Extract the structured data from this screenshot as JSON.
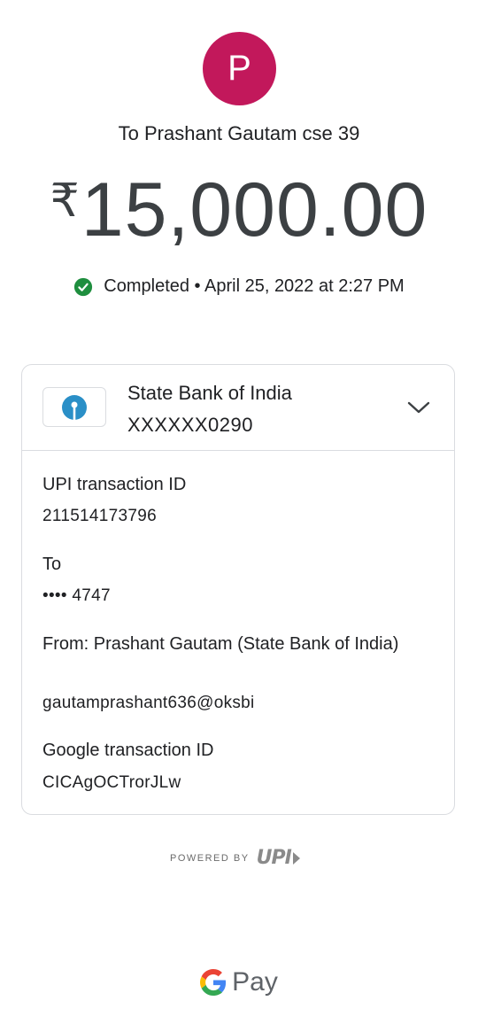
{
  "avatar": {
    "initial": "P",
    "color": "#c2185b"
  },
  "header": {
    "recipient_line": "To Prashant Gautam cse 39",
    "currency_symbol": "₹",
    "amount": "15,000.00",
    "status": "Completed • April 25, 2022 at 2:27 PM",
    "status_color": "#1e8e3e"
  },
  "bank": {
    "name": "State Bank of India",
    "account": "XXXXXX0290",
    "logo_color": "#2a8fc7",
    "expand_icon": "chevron-down-icon"
  },
  "details": {
    "upi_label": "UPI transaction ID",
    "upi_value": "211514173796",
    "to_label": "To",
    "to_value": "•••• 4747",
    "from_label": "From: Prashant  Gautam (State Bank of India)",
    "from_value": "gautamprashant636@oksbi",
    "google_label": "Google transaction ID",
    "google_value": "CICAgOCTrorJLw"
  },
  "footer": {
    "powered_by": "POWERED BY",
    "upi_logo_text": "UPI",
    "gpay_text": "Pay"
  }
}
